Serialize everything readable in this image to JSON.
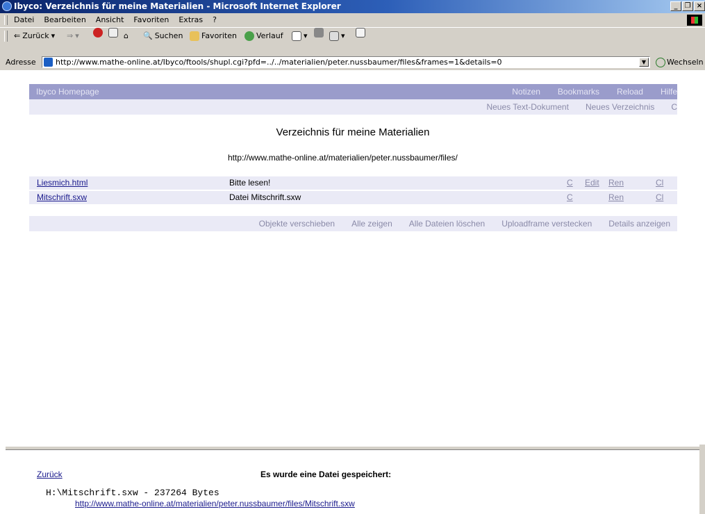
{
  "window": {
    "title": "Ibyco: Verzeichnis für meine Materialien - Microsoft Internet Explorer"
  },
  "menu": [
    "Datei",
    "Bearbeiten",
    "Ansicht",
    "Favoriten",
    "Extras",
    "?"
  ],
  "toolbar": {
    "back": "Zurück",
    "search": "Suchen",
    "favorites": "Favoriten",
    "history": "Verlauf"
  },
  "address": {
    "label": "Adresse",
    "url": "http://www.mathe-online.at/Ibyco/ftools/shupl.cgi?pfd=../../materialien/peter.nussbaumer/files&frames=1&details=0",
    "go": "Wechseln zu"
  },
  "nav": {
    "home": "Ibyco Homepage",
    "links": [
      "Notizen",
      "Bookmarks",
      "Reload",
      "Hilfe"
    ]
  },
  "subnav": [
    "Neues Text-Dokument",
    "Neues Verzeichnis",
    "C"
  ],
  "page": {
    "title": "Verzeichnis für meine Materialien",
    "url": "http://www.mathe-online.at/materialien/peter.nussbaumer/files/"
  },
  "files": [
    {
      "name": "Liesmich.html",
      "desc": "Bitte lesen!",
      "actions": [
        "C",
        "Edit",
        "Ren",
        "Cl"
      ]
    },
    {
      "name": "Mitschrift.sxw",
      "desc": "Datei Mitschrift.sxw",
      "actions": [
        "C",
        "",
        "Ren",
        "Cl"
      ]
    }
  ],
  "bottom_links": [
    "Objekte verschieben",
    "Alle zeigen",
    "Alle Dateien löschen",
    "Uploadframe verstecken",
    "Details anzeigen"
  ],
  "upload": {
    "back": "Zurück",
    "message": "Es wurde eine Datei gespeichert:",
    "file_line": "H:\\Mitschrift.sxw - 237264 Bytes",
    "file_url": "http://www.mathe-online.at/materialien/peter.nussbaumer/files/Mitschrift.sxw"
  }
}
